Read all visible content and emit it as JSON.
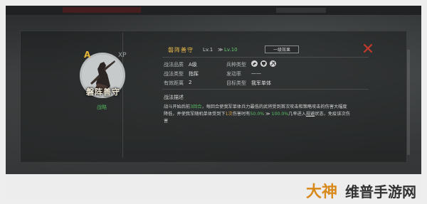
{
  "skill": {
    "name": "磐阵善守",
    "level": "Lv.1",
    "level_arrow": "≫",
    "level_max": "Lv.10",
    "effect_button": "一级效果",
    "rank_badge": "A",
    "xp_label": "XP",
    "strategy_link": "战略"
  },
  "attributes": {
    "quality_label": "战法品质",
    "quality_value": "A级",
    "type_label": "战法类型",
    "type_value": "指挥",
    "range_label": "有效距离",
    "range_value": "2",
    "troop_label": "兵种类型",
    "rate_label": "发动率",
    "rate_value": "——",
    "target_label": "目标类型",
    "target_value": "我军单体"
  },
  "description": {
    "heading": "战法描述",
    "p1": "战斗开始后前",
    "p1_g": "3回合",
    "p2": "，每回合使我军单体兵力最低的武将受到首次攻击和策略攻击的伤害大幅度降低，并使我军随机单体受到下",
    "p2_o": "1次",
    "p3": "伤害时有",
    "p3_g": "50.0%",
    "p3_arrow": " ≫ ",
    "p3_g2": "100.0%",
    "p4": "几率进入",
    "p4_u": "规避",
    "p5": "状态，免疫该次伤害"
  },
  "watermark": {
    "logo": "大神",
    "text": "维普手游网"
  },
  "colors": {
    "accent_gold": "#e7b64a",
    "accent_green": "#58bf63",
    "close_red": "#c0392b"
  }
}
